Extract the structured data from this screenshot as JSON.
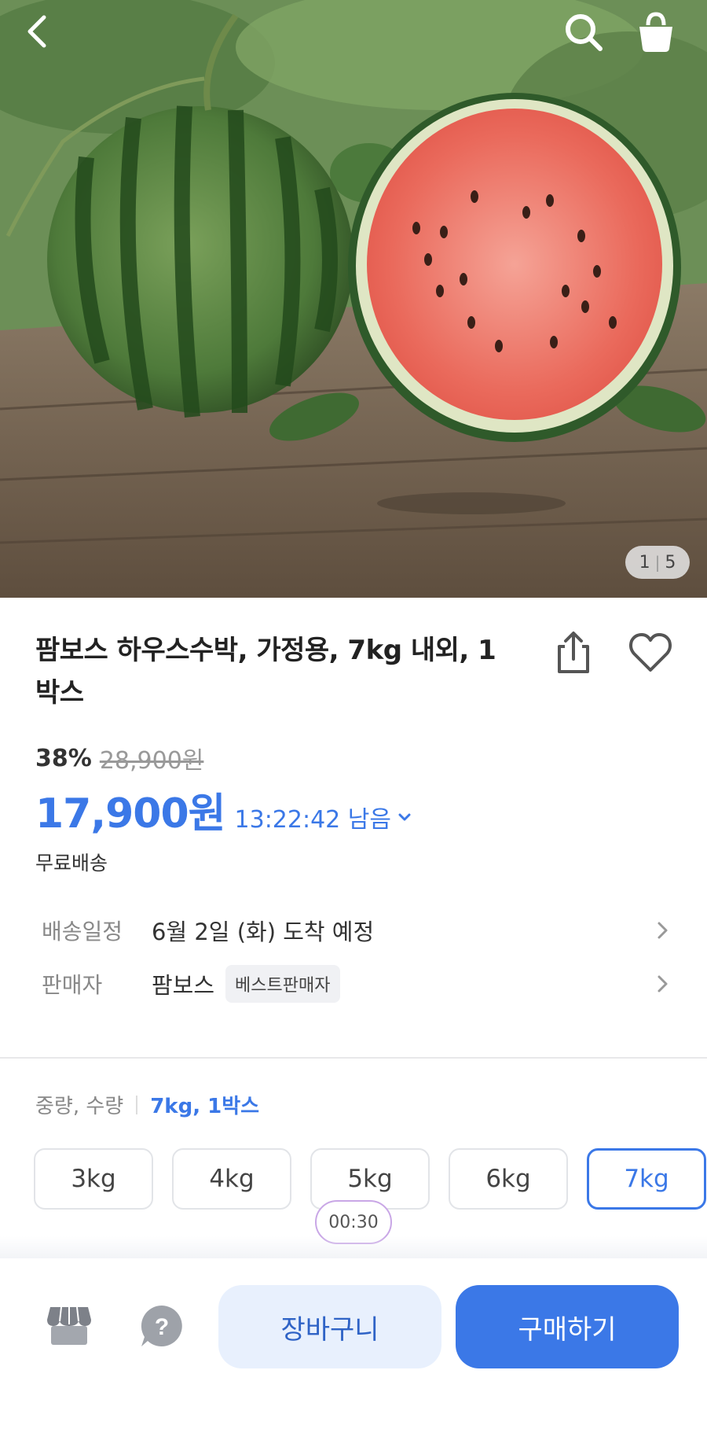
{
  "gallery": {
    "current": "1",
    "total": "5"
  },
  "icons": {
    "back": "chevron-left-icon",
    "search": "search-icon",
    "cart": "shopping-bag-icon",
    "share": "share-icon",
    "wishlist": "heart-icon",
    "store": "store-icon",
    "help": "help-icon"
  },
  "product": {
    "title": "팜보스 하우스수박, 가정용, 7kg 내외, 1박스",
    "discount": "38%",
    "original_price": "28,900원",
    "price": "17,900원",
    "time_left": "13:22:42 남음",
    "shipping_note": "무료배송"
  },
  "details": {
    "delivery_label": "배송일정",
    "delivery_value": "6월 2일 (화) 도착 예정",
    "seller_label": "판매자",
    "seller_value": "팜보스",
    "seller_badge": "베스트판매자"
  },
  "options": {
    "label": "중량, 수량",
    "selected": "7kg, 1박스",
    "weights": [
      "3kg",
      "4kg",
      "5kg",
      "6kg",
      "7kg"
    ],
    "selected_index": 4
  },
  "video_timer": "00:30",
  "actions": {
    "cart": "장바구니",
    "buy": "구매하기"
  },
  "colors": {
    "accent": "#3b78e7",
    "cart_button_bg": "#e8f0fd"
  }
}
